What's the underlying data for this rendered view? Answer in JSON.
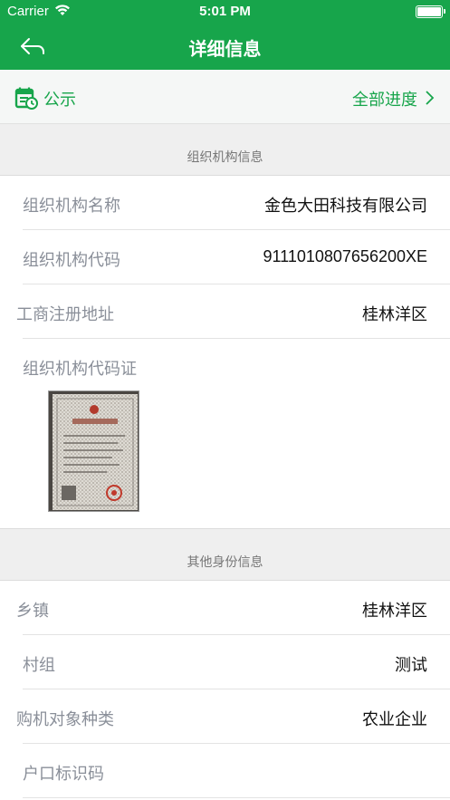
{
  "status_bar": {
    "carrier": "Carrier",
    "time": "5:01 PM"
  },
  "nav": {
    "title": "详细信息",
    "back_icon": "back-arrow-icon"
  },
  "notice": {
    "label": "公示",
    "progress_link": "全部进度",
    "icon": "calendar-clock-icon",
    "accent_color": "#17a54b"
  },
  "org_section": {
    "header": "组织机构信息",
    "rows": [
      {
        "label": "组织机构名称",
        "value": "金色大田科技有限公司"
      },
      {
        "label": "组织机构代码",
        "value": "9111010807656200XE"
      },
      {
        "label": "工商注册地址",
        "value": "桂林洋区"
      },
      {
        "label": "组织机构代码证",
        "value": ""
      }
    ]
  },
  "other_section": {
    "header": "其他身份信息",
    "rows": [
      {
        "label": "乡镇",
        "value": "桂林洋区"
      },
      {
        "label": "村组",
        "value": "测试"
      },
      {
        "label": "购机对象种类",
        "value": "农业企业"
      },
      {
        "label": "户口标识码",
        "value": ""
      }
    ]
  }
}
